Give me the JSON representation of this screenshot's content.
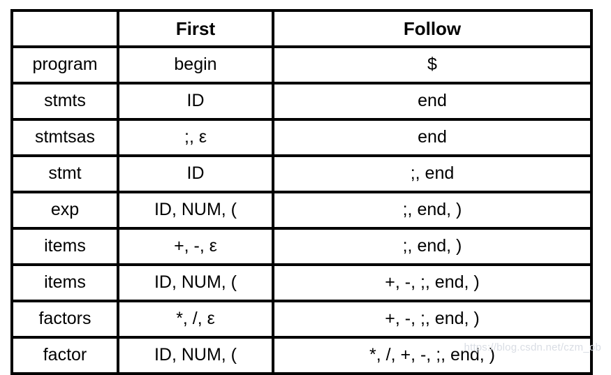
{
  "table": {
    "headers": {
      "symbol": "",
      "first": "First",
      "follow": "Follow"
    },
    "rows": [
      {
        "symbol": "program",
        "first": "begin",
        "follow": "$"
      },
      {
        "symbol": "stmts",
        "first": "ID",
        "follow": "end"
      },
      {
        "symbol": "stmtsas",
        "first": ";, ε",
        "follow": "end"
      },
      {
        "symbol": "stmt",
        "first": "ID",
        "follow": ";, end"
      },
      {
        "symbol": "exp",
        "first": "ID, NUM, (",
        "follow": ";, end, )"
      },
      {
        "symbol": "items",
        "first": "+, -, ε",
        "follow": ";, end, )"
      },
      {
        "symbol": "items",
        "first": "ID, NUM, (",
        "follow": "+, -, ;, end, )"
      },
      {
        "symbol": "factors",
        "first": "*, /,  ε",
        "follow": "+, -, ;, end, )"
      },
      {
        "symbol": "factor",
        "first": "ID, NUM, (",
        "follow": "*, /, +, -, ;, end, )"
      }
    ]
  },
  "watermark": {
    "text": "https://blog.csdn.net/czm_ob"
  },
  "colors": {
    "border": "#000000",
    "text": "#000000",
    "background": "#ffffff",
    "watermark": "#d9dde4"
  }
}
